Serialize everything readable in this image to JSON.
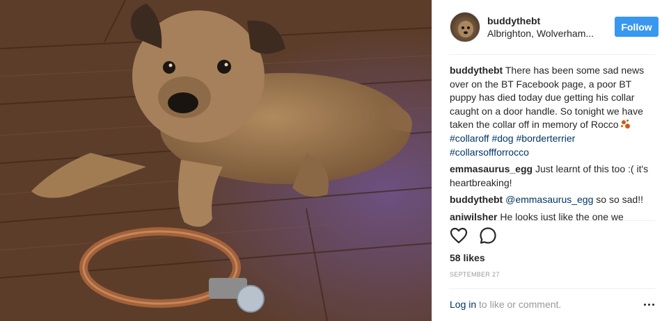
{
  "post": {
    "username": "buddythebt",
    "location": "Albrighton, Wolverham...",
    "follow_label": "Follow",
    "caption": {
      "author": "buddythebt",
      "text": "There has been some sad news over on the BT Facebook page, a poor BT puppy has died today due getting his collar caught on a door handle. So tonight we have taken the collar off in memory of Rocco",
      "emoji": "paw-prints-emoji",
      "hashtags": [
        "#collaroff",
        "#dog",
        "#borderterrier",
        "#collarsoffforrocco"
      ]
    },
    "comments": [
      {
        "author": "emmasaurus_egg",
        "text": "Just learnt of this too :( it's heartbreaking!"
      },
      {
        "author": "buddythebt",
        "mention": "@emmasaurus_egg",
        "text": "so so sad!!"
      },
      {
        "author": "aniwilsher",
        "text": "He looks just like the one we"
      }
    ],
    "likes": "58 likes",
    "date": "SEPTEMBER 27",
    "footer": {
      "login_link": "Log in",
      "rest": " to like or comment."
    }
  },
  "icons": {
    "like": "heart-icon",
    "comment": "comment-icon",
    "more": "more-options-icon"
  },
  "colors": {
    "follow_button": "#3897f0",
    "link": "#003569",
    "muted": "#999999",
    "emoji": "#c95d16"
  }
}
